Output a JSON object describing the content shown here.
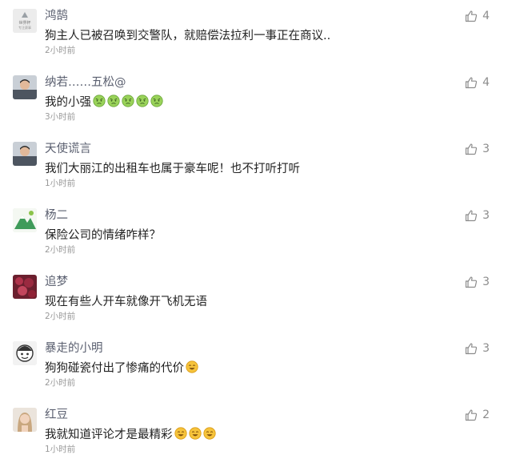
{
  "comments": [
    {
      "author": "鸿鹄",
      "text": "狗主人已被召唤到交警队，就赔偿法拉利一事正在商议..",
      "time": "2小时前",
      "likes": "4",
      "emojis": [],
      "avatar": "logo-avatar",
      "avatar_logo_text": [
        "世界杯",
        "专注赛事"
      ]
    },
    {
      "author": "纳若……五松@",
      "text": "我的小强",
      "time": "3小时前",
      "likes": "4",
      "emojis": [
        "angry-face",
        "angry-face",
        "angry-face",
        "angry-face",
        "angry-face"
      ],
      "avatar": "person-avatar"
    },
    {
      "author": "天使谎言",
      "text": "我们大丽江的出租车也属于豪车呢！也不打听打听",
      "time": "1小时前",
      "likes": "3",
      "emojis": [],
      "avatar": "person-avatar"
    },
    {
      "author": "杨二",
      "text": "保险公司的情绪咋样？",
      "time": "2小时前",
      "likes": "3",
      "emojis": [],
      "avatar": "mountain-avatar"
    },
    {
      "author": "追梦",
      "text": "现在有些人开车就像开飞机无语",
      "time": "2小时前",
      "likes": "3",
      "emojis": [],
      "avatar": "flower-avatar"
    },
    {
      "author": "暴走的小明",
      "text": "狗狗碰瓷付出了惨痛的代价",
      "time": "2小时前",
      "likes": "3",
      "emojis": [
        "grin-face"
      ],
      "avatar": "cartoon-avatar"
    },
    {
      "author": "红豆",
      "text": "我就知道评论才是最精彩",
      "time": "1小时前",
      "likes": "2",
      "emojis": [
        "grin-face",
        "grin-face",
        "grin-face"
      ],
      "avatar": "girl-avatar"
    }
  ],
  "colors": {
    "name": "#5b6070",
    "text": "#222222",
    "time": "#9a9a9a",
    "like": "#8c8c8c"
  },
  "icons": {
    "like": "thumb-up-icon"
  }
}
